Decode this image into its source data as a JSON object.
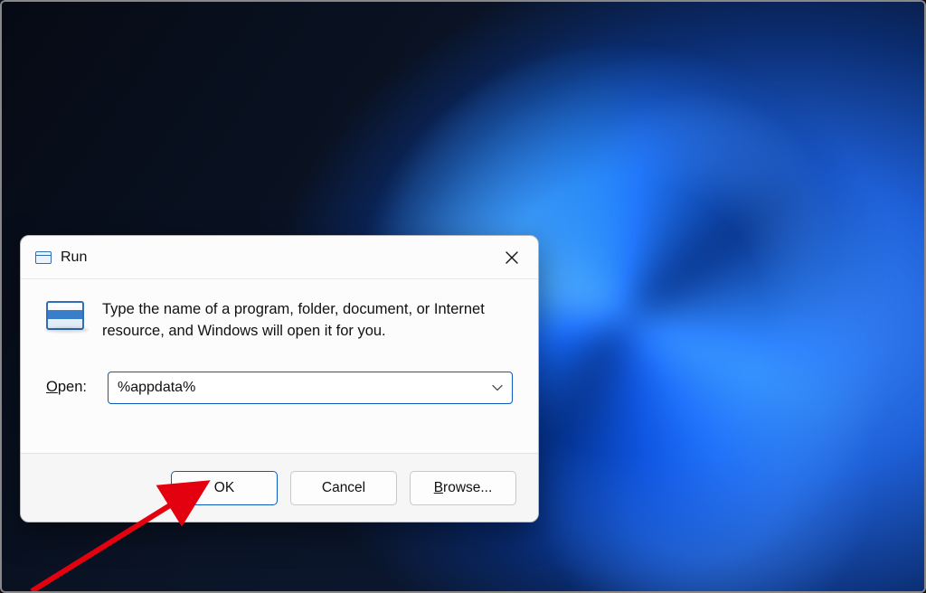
{
  "dialog": {
    "title": "Run",
    "prompt": "Type the name of a program, folder, document, or Internet resource, and Windows will open it for you.",
    "open_label_prefix": "O",
    "open_label_rest": "pen:",
    "open_value": "%appdata%",
    "buttons": {
      "ok": "OK",
      "cancel": "Cancel",
      "browse_prefix": "B",
      "browse_rest": "rowse..."
    }
  },
  "icons": {
    "run_app": "run-dialog-icon",
    "close": "close-icon",
    "dropdown": "chevron-down-icon"
  },
  "annotation": {
    "arrow_target": "ok-button"
  }
}
